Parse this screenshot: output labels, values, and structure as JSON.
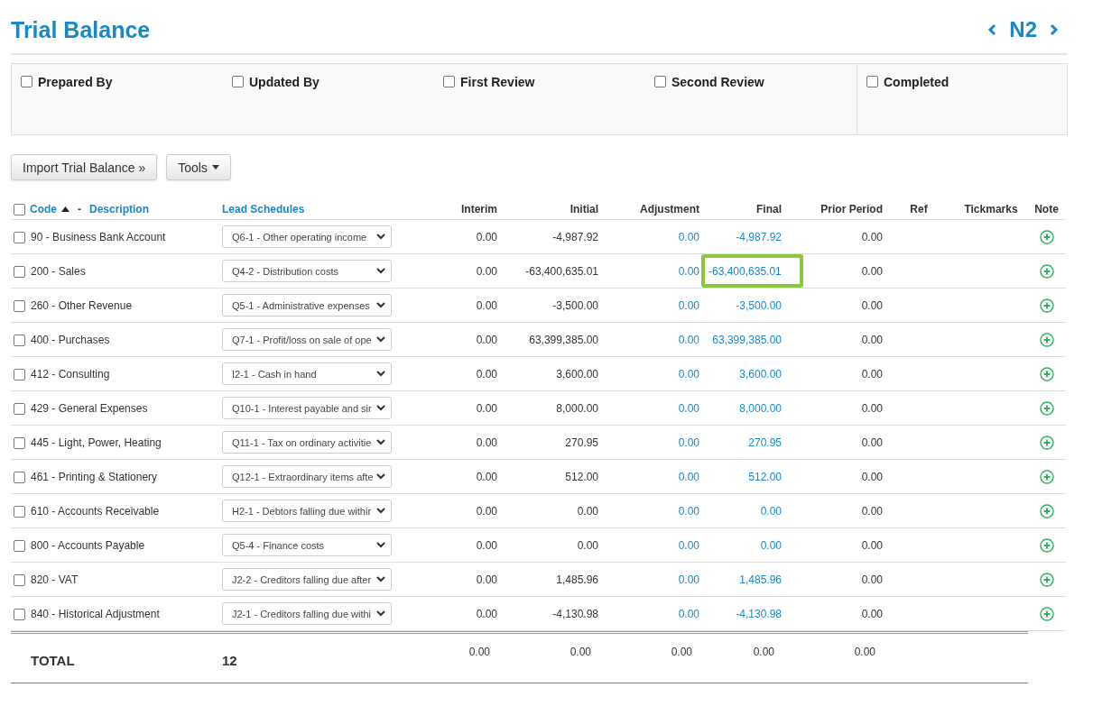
{
  "header": {
    "title": "Trial Balance",
    "page": "N2"
  },
  "signoffs": [
    {
      "label": "Prepared By",
      "checked": false
    },
    {
      "label": "Updated By",
      "checked": false
    },
    {
      "label": "First Review",
      "checked": false
    },
    {
      "label": "Second Review",
      "checked": false
    },
    {
      "label": "Completed",
      "checked": false
    }
  ],
  "buttons": {
    "import": "Import Trial Balance »",
    "tools": "Tools"
  },
  "table": {
    "select_all_checked": false,
    "columns": {
      "code": "Code",
      "separator": "-",
      "description": "Description",
      "lead": "Lead Schedules",
      "interim": "Interim",
      "initial": "Initial",
      "adjustment": "Adjustment",
      "final": "Final",
      "prior": "Prior Period",
      "ref": "Ref",
      "tickmarks": "Tickmarks",
      "note": "Note"
    },
    "rows": [
      {
        "account": "90 - Business Bank Account",
        "lead": "Q6-1 - Other operating income",
        "interim": "0.00",
        "initial": "-4,987.92",
        "adjustment": "0.00",
        "final": "-4,987.92",
        "prior": "0.00",
        "checked": false,
        "highlighted": false
      },
      {
        "account": "200 - Sales",
        "lead": "Q4-2 - Distribution costs",
        "interim": "0.00",
        "initial": "-63,400,635.01",
        "adjustment": "0.00",
        "final": "-63,400,635.01",
        "prior": "0.00",
        "checked": false,
        "highlighted": true
      },
      {
        "account": "260 - Other Revenue",
        "lead": "Q5-1 - Administrative expenses",
        "interim": "0.00",
        "initial": "-3,500.00",
        "adjustment": "0.00",
        "final": "-3,500.00",
        "prior": "0.00",
        "checked": false,
        "highlighted": false
      },
      {
        "account": "400 - Purchases",
        "lead": "Q7-1 - Profit/loss on sale of ope",
        "interim": "0.00",
        "initial": "63,399,385.00",
        "adjustment": "0.00",
        "final": "63,399,385.00",
        "prior": "0.00",
        "checked": false,
        "highlighted": false
      },
      {
        "account": "412 - Consulting",
        "lead": "I2-1 - Cash in hand",
        "interim": "0.00",
        "initial": "3,600.00",
        "adjustment": "0.00",
        "final": "3,600.00",
        "prior": "0.00",
        "checked": false,
        "highlighted": false
      },
      {
        "account": "429 - General Expenses",
        "lead": "Q10-1 - Interest payable and sir",
        "interim": "0.00",
        "initial": "8,000.00",
        "adjustment": "0.00",
        "final": "8,000.00",
        "prior": "0.00",
        "checked": false,
        "highlighted": false
      },
      {
        "account": "445 - Light, Power, Heating",
        "lead": "Q11-1 - Tax on ordinary activitie",
        "interim": "0.00",
        "initial": "270.95",
        "adjustment": "0.00",
        "final": "270.95",
        "prior": "0.00",
        "checked": false,
        "highlighted": false
      },
      {
        "account": "461 - Printing & Stationery",
        "lead": "Q12-1 - Extraordinary items afte",
        "interim": "0.00",
        "initial": "512.00",
        "adjustment": "0.00",
        "final": "512.00",
        "prior": "0.00",
        "checked": false,
        "highlighted": false
      },
      {
        "account": "610 - Accounts Receivable",
        "lead": "H2-1 - Debtors falling due withir",
        "interim": "0.00",
        "initial": "0.00",
        "adjustment": "0.00",
        "final": "0.00",
        "prior": "0.00",
        "checked": false,
        "highlighted": false
      },
      {
        "account": "800 - Accounts Payable",
        "lead": "Q5-4 - Finance costs",
        "interim": "0.00",
        "initial": "0.00",
        "adjustment": "0.00",
        "final": "0.00",
        "prior": "0.00",
        "checked": false,
        "highlighted": false
      },
      {
        "account": "820 - VAT",
        "lead": "J2-2 - Creditors falling due after",
        "interim": "0.00",
        "initial": "1,485.96",
        "adjustment": "0.00",
        "final": "1,485.96",
        "prior": "0.00",
        "checked": false,
        "highlighted": false
      },
      {
        "account": "840 - Historical Adjustment",
        "lead": "J2-1 - Creditors falling due withi",
        "interim": "0.00",
        "initial": "-4,130.98",
        "adjustment": "0.00",
        "final": "-4,130.98",
        "prior": "0.00",
        "checked": false,
        "highlighted": false
      }
    ],
    "total": {
      "label": "TOTAL",
      "count": "12",
      "values": [
        "0.00",
        "0.00",
        "0.00",
        "0.00",
        "0.00"
      ]
    }
  }
}
